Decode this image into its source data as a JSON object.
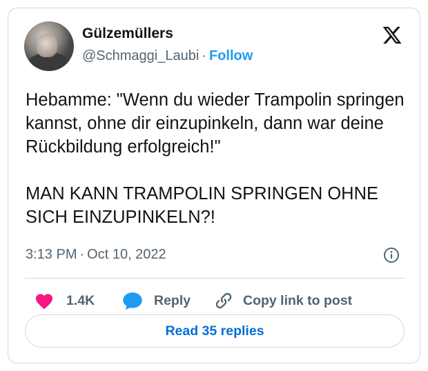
{
  "author": {
    "display_name": "Gülzemüllers",
    "handle": "@Schmaggi_Laubi",
    "separator": "·",
    "follow_label": "Follow"
  },
  "tweet": {
    "paragraphs": [
      "Hebamme: \"Wenn du wieder Trampolin springen kannst, ohne dir einzupinkeln, dann war deine Rückbildung erfolgreich!\"",
      "MAN KANN TRAMPOLIN SPRINGEN OHNE SICH EINZUPINKELN?!"
    ],
    "time": "3:13 PM",
    "date_separator": "·",
    "date": "Oct 10, 2022"
  },
  "actions": {
    "like_count": "1.4K",
    "reply_label": "Reply",
    "copy_label": "Copy link to post"
  },
  "footer": {
    "read_replies_label": "Read 35 replies"
  },
  "icons": {
    "brand": "x-logo-icon",
    "info": "info-icon",
    "like": "heart-icon",
    "reply": "speech-bubble-icon",
    "copy": "link-icon"
  },
  "colors": {
    "accent": "#1d9bf0",
    "like": "#f91880",
    "read_replies": "#006fd6",
    "muted": "#536471",
    "border": "#cfd9de"
  }
}
